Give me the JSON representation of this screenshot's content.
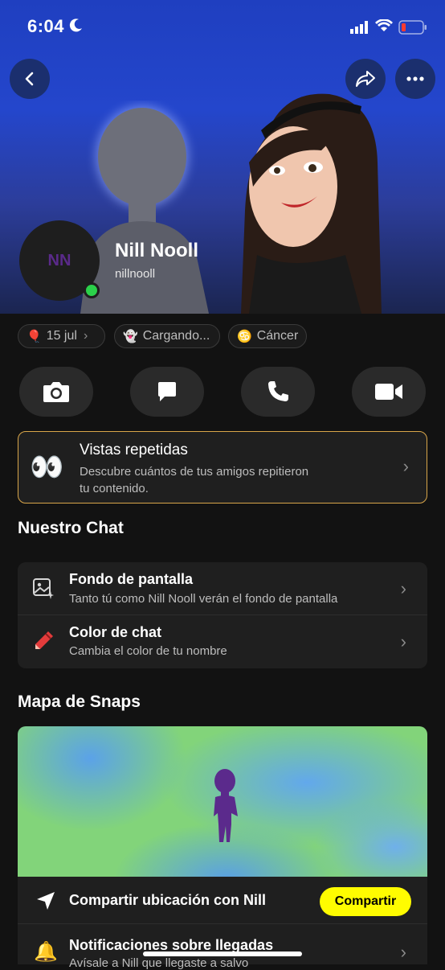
{
  "status_bar": {
    "time": "6:04"
  },
  "profile": {
    "initials": "NN",
    "name": "Nill Nooll",
    "username": "nillnooll"
  },
  "pills": [
    {
      "icon": "🎈",
      "label": "15 jul",
      "chevron": "›"
    },
    {
      "icon": "👻",
      "label": "Cargando..."
    },
    {
      "icon": "♋",
      "label": "Cáncer"
    }
  ],
  "views_card": {
    "emoji": "👀",
    "title": "Vistas repetidas",
    "subtitle_line1": "Descubre cuántos de tus amigos repitieron",
    "subtitle_line2": "tu contenido."
  },
  "chat_section": {
    "heading": "Nuestro Chat",
    "items": [
      {
        "title": "Fondo de pantalla",
        "subtitle": "Tanto tú como Nill Nooll verán el fondo de pantalla"
      },
      {
        "title": "Color de chat",
        "subtitle": "Cambia el color de tu nombre"
      }
    ]
  },
  "map_section": {
    "heading": "Mapa de Snaps",
    "share_location": "Compartir ubicación con Nill",
    "share_button": "Compartir",
    "notifications_title": "Notificaciones sobre llegadas",
    "notifications_sub": "Avísale a Nill que llegaste a salvo"
  },
  "colors": {
    "accent_yellow": "#fffc00",
    "online": "#2bd14a",
    "card_border": "#d9a64a"
  }
}
